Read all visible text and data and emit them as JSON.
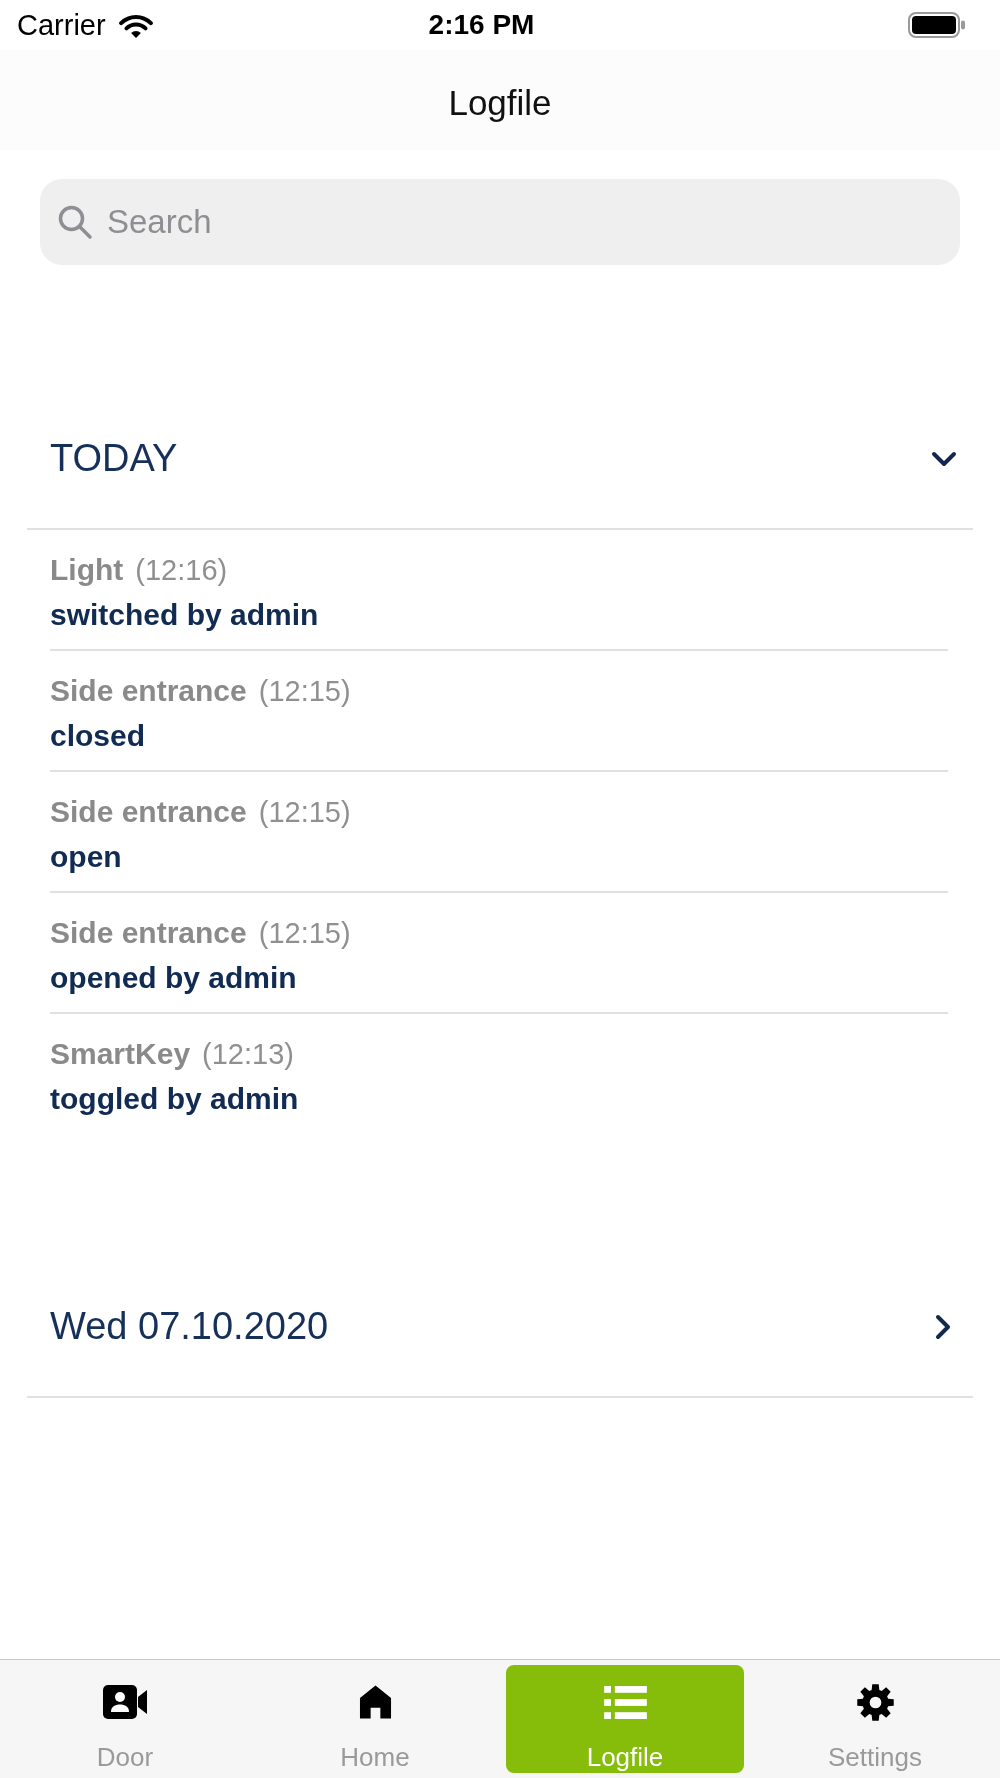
{
  "status_bar": {
    "carrier": "Carrier",
    "time": "2:16 PM"
  },
  "nav_bar": {
    "title": "Logfile"
  },
  "search": {
    "placeholder": "Search"
  },
  "sections": [
    {
      "title": "TODAY",
      "expanded": true,
      "entries": [
        {
          "device": "Light",
          "time": "(12:16)",
          "action": "switched by admin"
        },
        {
          "device": "Side entrance",
          "time": "(12:15)",
          "action": "closed"
        },
        {
          "device": "Side entrance",
          "time": "(12:15)",
          "action": "open"
        },
        {
          "device": "Side entrance",
          "time": "(12:15)",
          "action": "opened by admin"
        },
        {
          "device": "SmartKey",
          "time": "(12:13)",
          "action": "toggled by admin"
        }
      ]
    },
    {
      "title": "Wed 07.10.2020",
      "expanded": false
    }
  ],
  "tab_bar": {
    "items": [
      {
        "label": "Door",
        "selected": false
      },
      {
        "label": "Home",
        "selected": false
      },
      {
        "label": "Logfile",
        "selected": true
      },
      {
        "label": "Settings",
        "selected": false
      }
    ]
  }
}
